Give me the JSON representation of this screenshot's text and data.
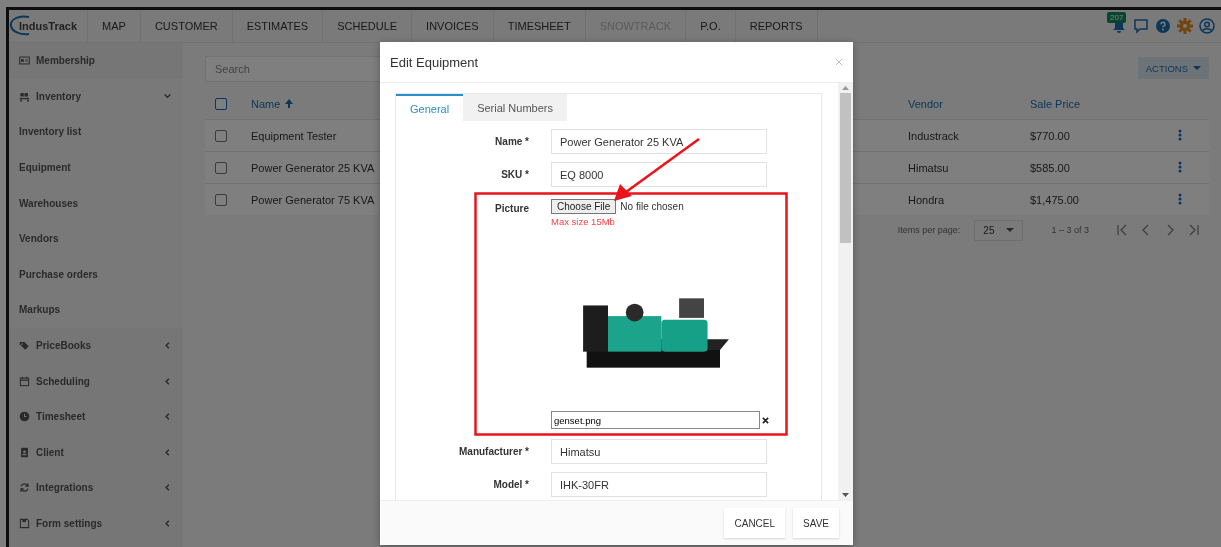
{
  "nav": {
    "logo": "IndusTrack",
    "items": [
      {
        "label": "MAP",
        "disabled": false
      },
      {
        "label": "CUSTOMER",
        "disabled": false
      },
      {
        "label": "ESTIMATES",
        "disabled": false
      },
      {
        "label": "SCHEDULE",
        "disabled": false
      },
      {
        "label": "INVOICES",
        "disabled": false
      },
      {
        "label": "TIMESHEET",
        "disabled": false
      },
      {
        "label": "SNOWTRACK",
        "disabled": true
      },
      {
        "label": "P.O.",
        "disabled": false
      },
      {
        "label": "REPORTS",
        "disabled": false
      }
    ],
    "notification_count": "207"
  },
  "sidebar": {
    "items": [
      {
        "label": "Membership",
        "kind": "link"
      },
      {
        "label": "Inventory",
        "kind": "group",
        "expanded": true,
        "children": [
          {
            "label": "Inventory list"
          },
          {
            "label": "Equipment"
          },
          {
            "label": "Warehouses"
          },
          {
            "label": "Vendors"
          },
          {
            "label": "Purchase orders"
          },
          {
            "label": "Markups"
          }
        ]
      },
      {
        "label": "PriceBooks",
        "kind": "group",
        "expanded": false
      },
      {
        "label": "Scheduling",
        "kind": "group",
        "expanded": false
      },
      {
        "label": "Timesheet",
        "kind": "group",
        "expanded": false
      },
      {
        "label": "Client",
        "kind": "group",
        "expanded": false
      },
      {
        "label": "Integrations",
        "kind": "group",
        "expanded": false
      },
      {
        "label": "Form settings",
        "kind": "group",
        "expanded": false
      }
    ]
  },
  "search": {
    "placeholder": "Search"
  },
  "actions_button": "ACTIONS",
  "table": {
    "select_all_checked": false,
    "columns": [
      {
        "label": "Name",
        "sorted": true
      },
      {
        "label": "Vendor",
        "sorted": false
      },
      {
        "label": "Sale Price",
        "sorted": false
      }
    ],
    "rows": [
      {
        "name": "Equipment Tester",
        "vendor": "Industrack",
        "sale_price": "$770.00",
        "checked": false
      },
      {
        "name": "Power Generator 25 KVA",
        "vendor": "Himatsu",
        "sale_price": "$585.00",
        "checked": false
      },
      {
        "name": "Power Generator 75 KVA",
        "vendor": "Hondra",
        "sale_price": "$1,475.00",
        "checked": false
      }
    ]
  },
  "pagination": {
    "items_per_page_label": "Items per page:",
    "page_size": "25",
    "range": "1 – 3 of 3"
  },
  "modal": {
    "title": "Edit Equipment",
    "tabs": [
      {
        "label": "General",
        "selected": true
      },
      {
        "label": "Serial Numbers",
        "selected": false
      }
    ],
    "fields": [
      {
        "kind": "text",
        "label": "Name *",
        "value": "Power Generator 25 KVA"
      },
      {
        "kind": "text",
        "label": "SKU *",
        "value": "EQ 8000"
      },
      {
        "kind": "file",
        "label": "Picture",
        "button": "Choose File",
        "status": "No file chosen",
        "hint": "Max size 15Mb",
        "filename": "genset.png"
      },
      {
        "kind": "text",
        "label": "Manufacturer *",
        "value": "Himatsu"
      },
      {
        "kind": "text",
        "label": "Model *",
        "value": "IHK-30FR"
      }
    ],
    "buttons": [
      "CANCEL",
      "SAVE"
    ]
  }
}
